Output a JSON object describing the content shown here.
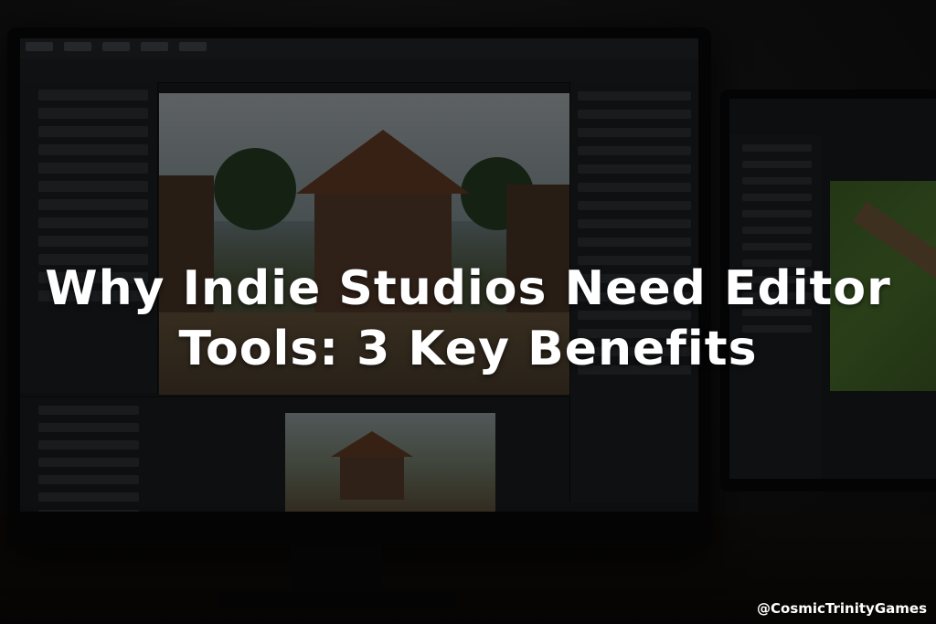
{
  "headline": {
    "line1": "Why Indie Studios Need Editor",
    "line2": "Tools: 3 Key Benefits"
  },
  "watermark": "@CosmicTrinityGames",
  "colors": {
    "headline_text": "#ffffff",
    "overlay": "#000000"
  },
  "background_description_icons": [
    "monitor-icon"
  ]
}
